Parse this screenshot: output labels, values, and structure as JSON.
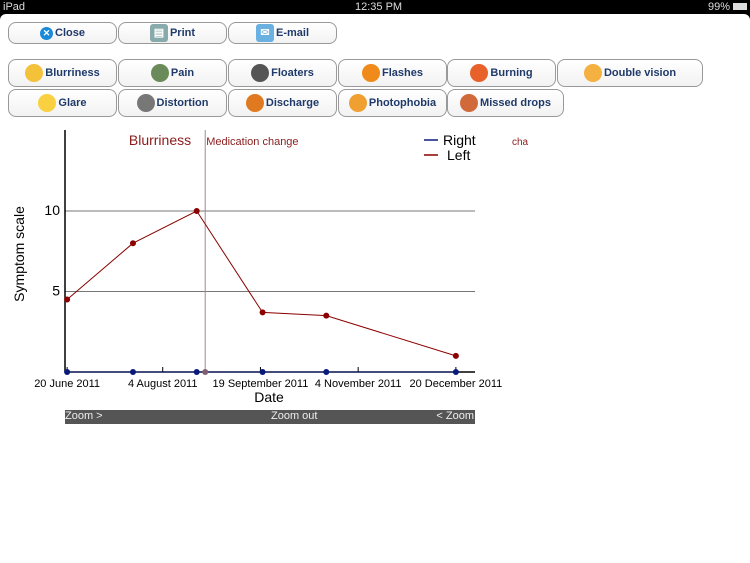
{
  "status_bar": {
    "device": "iPad",
    "time": "12:35 PM",
    "battery": "99%"
  },
  "toolbar": {
    "close": "Close",
    "print": "Print",
    "email": "E-mail"
  },
  "symptoms": [
    {
      "label": "Blurriness",
      "icon": "blurry-face-icon",
      "color": "#f4c23a"
    },
    {
      "label": "Pain",
      "icon": "eye-icon",
      "color": "#6a8a5a"
    },
    {
      "label": "Floaters",
      "icon": "floaters-icon",
      "color": "#555555"
    },
    {
      "label": "Flashes",
      "icon": "lightning-icon",
      "color": "#f08a1a"
    },
    {
      "label": "Burning",
      "icon": "burning-face-icon",
      "color": "#e8602a"
    },
    {
      "label": "Double vision",
      "icon": "double-face-icon",
      "color": "#f4b040"
    },
    {
      "label": "Glare",
      "icon": "glare-face-icon",
      "color": "#f8d040"
    },
    {
      "label": "Distortion",
      "icon": "distortion-grid-icon",
      "color": "#777777"
    },
    {
      "label": "Discharge",
      "icon": "discharge-icon",
      "color": "#e07a20"
    },
    {
      "label": "Photophobia",
      "icon": "photophobia-face-icon",
      "color": "#f0a030"
    },
    {
      "label": "Missed drops",
      "icon": "missed-drops-icon",
      "color": "#d06a3a"
    }
  ],
  "zoom": {
    "zoom_in": "Zoom >",
    "zoom_out": "Zoom out",
    "zoom_back": "< Zoom"
  },
  "chart_data": {
    "type": "line",
    "title": "Blurriness",
    "annotation": {
      "label": "Medication change",
      "date": "2011-08-24"
    },
    "overflow_label": "cha",
    "xlabel": "Date",
    "ylabel": "Symptom scale",
    "xlim": [
      "2011-06-19",
      "2011-12-29"
    ],
    "ylim": [
      0,
      14.5
    ],
    "x_ticks": [
      {
        "date": "2011-06-20",
        "label": "20 June 2011"
      },
      {
        "date": "2011-08-04",
        "label": "4 August 2011"
      },
      {
        "date": "2011-09-19",
        "label": "19 September 2011"
      },
      {
        "date": "2011-11-04",
        "label": "4 November 2011"
      },
      {
        "date": "2011-12-20",
        "label": "20 December 2011"
      }
    ],
    "y_ticks": [
      5,
      10
    ],
    "grid": true,
    "legend": "top-right",
    "series": [
      {
        "name": "Right",
        "color": "#0a1a7a",
        "x": [
          "2011-06-20",
          "2011-07-21",
          "2011-08-20",
          "2011-09-20",
          "2011-10-20",
          "2011-12-20"
        ],
        "values": [
          0,
          0,
          0,
          0,
          0,
          0
        ]
      },
      {
        "name": "Left",
        "color": "#8b0000",
        "x": [
          "2011-06-20",
          "2011-07-21",
          "2011-08-20",
          "2011-09-20",
          "2011-10-20",
          "2011-12-20"
        ],
        "values": [
          4.5,
          8,
          10,
          3.7,
          3.5,
          1
        ]
      }
    ]
  }
}
